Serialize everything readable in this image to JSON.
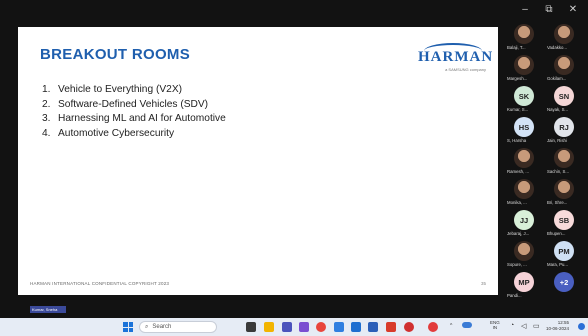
{
  "slide": {
    "title": "BREAKOUT ROOMS",
    "logo": "HARMAN",
    "logo_sub": "a SAMSUNG company",
    "items": [
      {
        "num": "1.",
        "text": "Vehicle to Everything (V2X)"
      },
      {
        "num": "2.",
        "text": "Software-Defined Vehicles (SDV)"
      },
      {
        "num": "3.",
        "text": "Harnessing ML and AI for Automotive"
      },
      {
        "num": "4.",
        "text": "Automotive Cybersecurity"
      }
    ],
    "footer": "HARMAN INTERNATIONAL CONFIDENTIAL COPYRIGHT 2023",
    "page_number": "35"
  },
  "window": {
    "minimize": "–",
    "restore": "⧉",
    "close": "✕"
  },
  "participants": [
    {
      "name": "Balaji, T...",
      "initials": "",
      "color": ""
    },
    {
      "name": "Vadakko...",
      "initials": "",
      "color": ""
    },
    {
      "name": "Margesh...",
      "initials": "",
      "color": ""
    },
    {
      "name": "Gokilam...",
      "initials": "",
      "color": ""
    },
    {
      "name": "Kumar, S...",
      "initials": "SK",
      "color": "#cfe8d6"
    },
    {
      "name": "Nayak, S...",
      "initials": "SN",
      "color": "#f4d6d6"
    },
    {
      "name": "S, Harsha",
      "initials": "HS",
      "color": "#d3e3f6"
    },
    {
      "name": "Jain, Rishi",
      "initials": "RJ",
      "color": "#e1e4ea"
    },
    {
      "name": "Ramesh, ...",
      "initials": "",
      "color": ""
    },
    {
      "name": "Sachin, S...",
      "initials": "",
      "color": ""
    },
    {
      "name": "Monika, ...",
      "initials": "",
      "color": ""
    },
    {
      "name": "Bri, Shre...",
      "initials": "",
      "color": ""
    },
    {
      "name": "Jebaraj, J...",
      "initials": "JJ",
      "color": "#d9f0d9"
    },
    {
      "name": "Bhupen...",
      "initials": "SB",
      "color": "#f7dada"
    },
    {
      "name": "Sopure, ...",
      "initials": "",
      "color": ""
    },
    {
      "name": "Mara, Pu...",
      "initials": "PM",
      "color": "#cfe0f3"
    },
    {
      "name": "Pandi...",
      "initials": "MP",
      "color": "#f6d3d8"
    },
    {
      "name": "",
      "initials": "+2",
      "color": "#4a5fc1"
    }
  ],
  "self_tag": "Kumar, Sneha",
  "taskbar": {
    "search_placeholder": "Search",
    "lang": "ENG",
    "region": "IN",
    "time": "12:55",
    "date": "10-06-2024"
  }
}
